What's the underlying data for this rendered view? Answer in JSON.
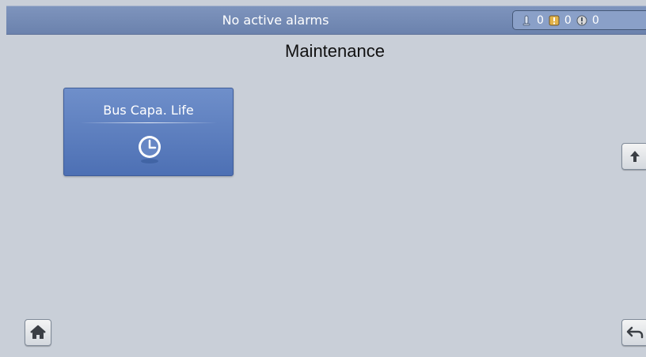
{
  "status_bar": {
    "title": "No active alarms",
    "alarms": [
      {
        "icon": "info-alarm-icon",
        "count": "0"
      },
      {
        "icon": "warning-alarm-icon",
        "count": "0"
      },
      {
        "icon": "critical-alarm-icon",
        "count": "0"
      }
    ]
  },
  "page": {
    "title": "Maintenance"
  },
  "tiles": [
    {
      "label": "Bus Capa. Life",
      "icon": "clock-icon"
    }
  ],
  "nav": {
    "up": "arrow-up-icon",
    "home": "home-icon",
    "back": "back-arrow-icon"
  },
  "colors": {
    "background": "#c9cfd8",
    "status_bar": "#7e94bd",
    "tile": "#5b7fc0"
  }
}
